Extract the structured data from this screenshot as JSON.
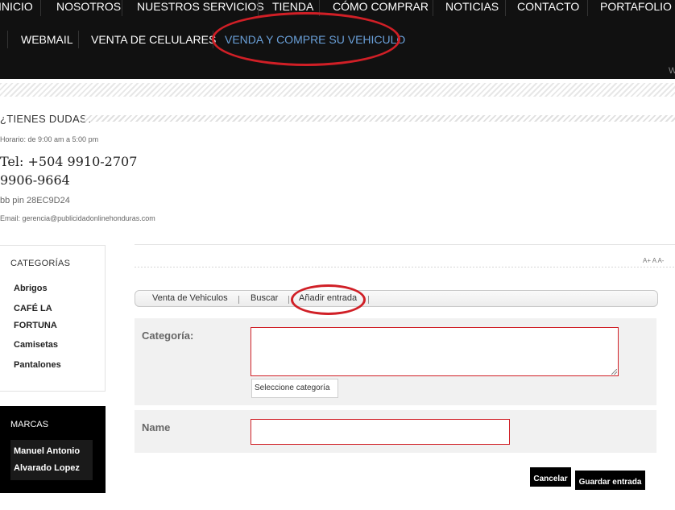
{
  "nav": {
    "row1": [
      "INICIO",
      "NOSOTROS",
      "NUESTROS SERVICIOS",
      "TIENDA",
      "CÓMO COMPRAR",
      "NOTICIAS",
      "CONTACTO",
      "PORTAFOLIO"
    ],
    "row2": [
      "WEBMAIL",
      "VENTA DE CELULARES",
      "VENDA Y COMPRE SU VEHICULO"
    ],
    "overflow_mark": "W"
  },
  "contact": {
    "title": "¿TIENES DUDAS?",
    "hours": "Horario: de 9:00 am a 5:00 pm",
    "phone1": "Tel: +504 9910-2707",
    "phone2": "9906-9664",
    "bb_pin": "bb pin 28EC9D24",
    "email": "Email: gerencia@publicidadonlinehonduras.com"
  },
  "categories": {
    "title": "CATEGORÍAS",
    "items": [
      "Abrigos",
      "CAFÉ LA FORTUNA",
      "Camisetas",
      "Pantalones"
    ]
  },
  "brands": {
    "title": "MARCAS",
    "item": "Manuel Antonio Alvarado Lopez"
  },
  "font_sizer": "A+ A A-",
  "tabs": [
    "Venta de Vehiculos",
    "Buscar",
    "Añadir entrada"
  ],
  "form": {
    "category_label": "Categoría:",
    "category_value": "",
    "select_button": "Seleccione categoría",
    "name_label": "Name",
    "name_value": ""
  },
  "actions": {
    "cancel": "Cancelar",
    "save": "Guardar entrada"
  },
  "colors": {
    "nav_bg": "#111111",
    "nav_active": "#6aa0d9",
    "highlight_ellipse": "#d01f26",
    "form_bg": "#f1f1f1"
  }
}
